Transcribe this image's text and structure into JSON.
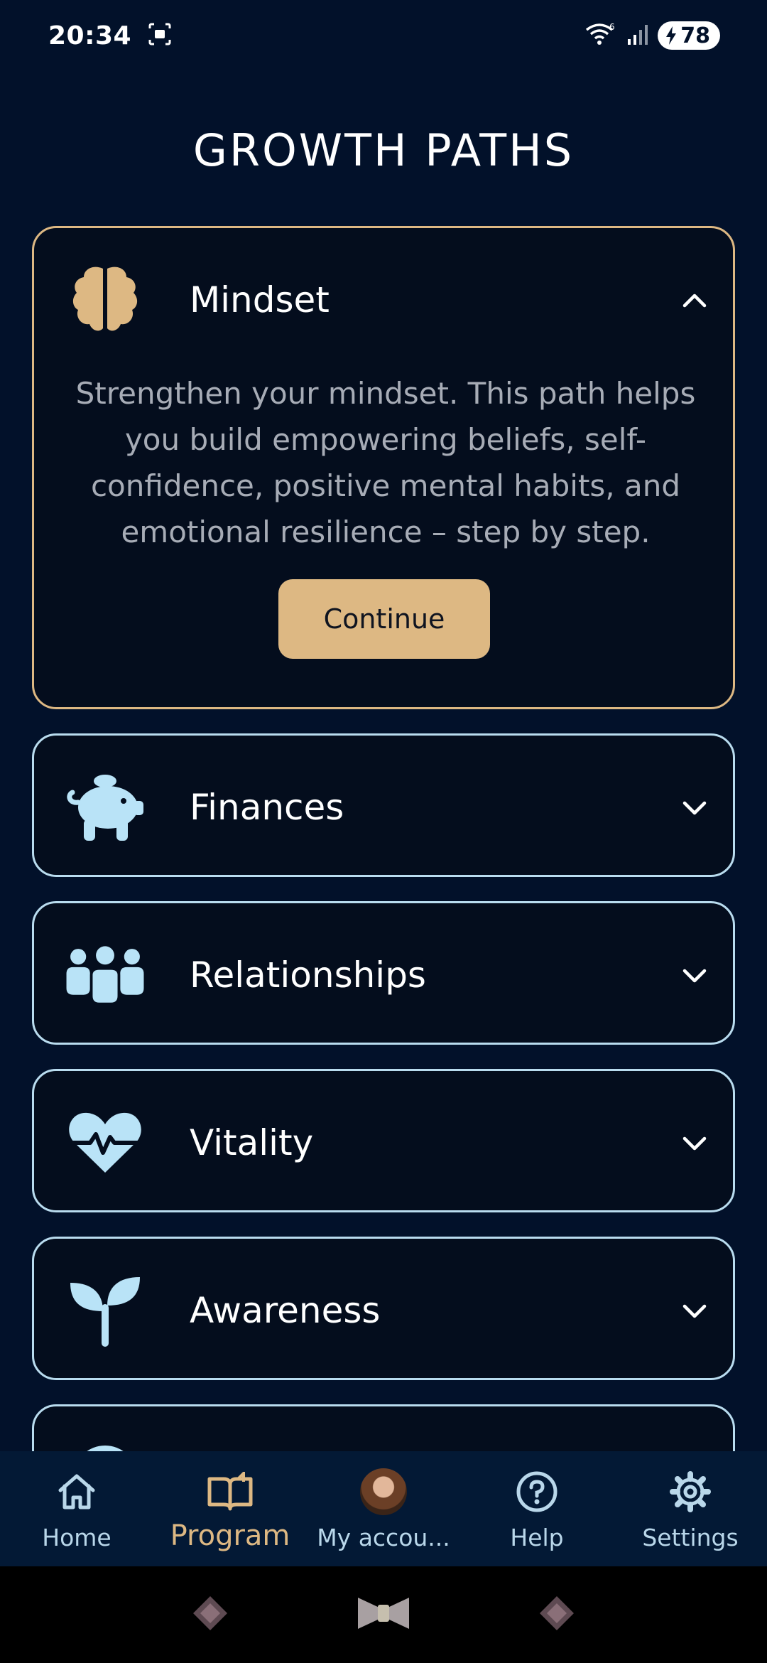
{
  "status": {
    "time": "20:34",
    "battery": "78"
  },
  "page": {
    "title": "GROWTH PATHS"
  },
  "paths": [
    {
      "title": "Mindset",
      "icon": "brain-icon",
      "expanded": true,
      "description": "Strengthen your mindset. This path helps you build empowering beliefs, self-confidence, positive mental habits, and emotional resilience – step by step.",
      "button": "Continue"
    },
    {
      "title": "Finances",
      "icon": "piggy-bank-icon",
      "expanded": false
    },
    {
      "title": "Relationships",
      "icon": "people-group-icon",
      "expanded": false
    },
    {
      "title": "Vitality",
      "icon": "heart-pulse-icon",
      "expanded": false
    },
    {
      "title": "Awareness",
      "icon": "sprout-icon",
      "expanded": false
    }
  ],
  "nav": {
    "items": [
      {
        "label": "Home",
        "icon": "home-icon"
      },
      {
        "label": "Program",
        "icon": "book-icon",
        "active": true
      },
      {
        "label": "My accou...",
        "icon": "avatar"
      },
      {
        "label": "Help",
        "icon": "help-icon"
      },
      {
        "label": "Settings",
        "icon": "gear-icon"
      }
    ]
  },
  "colors": {
    "background": "#02112a",
    "accent": "#ddb883",
    "icon": "#b9e3f7",
    "border": "#b9dcef"
  }
}
